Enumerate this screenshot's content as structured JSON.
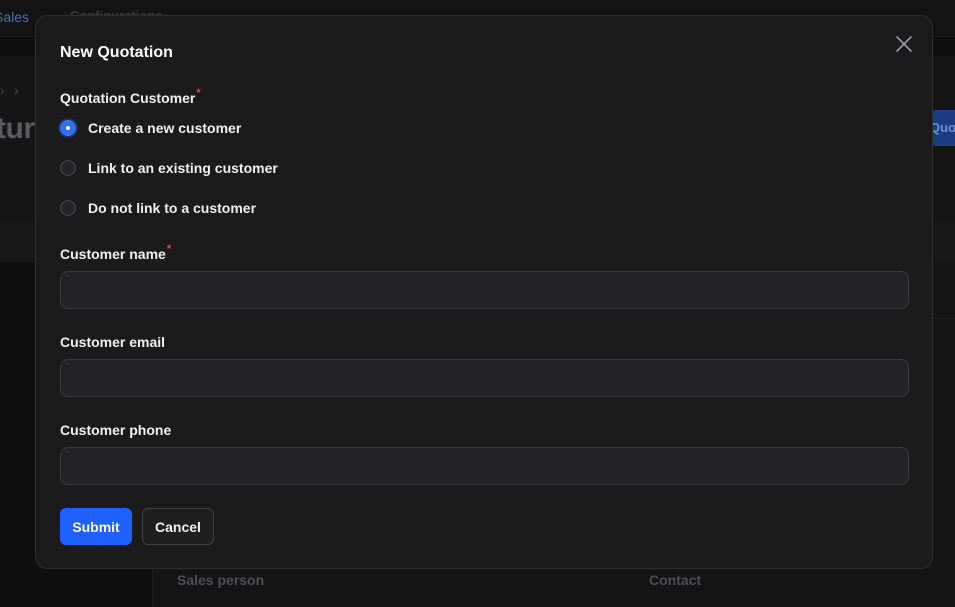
{
  "background": {
    "tabs": [
      "Sales",
      "Configurations"
    ],
    "page_title": "tur",
    "primary_action": "Quo",
    "card_labels": [
      "Sales person",
      "Contact"
    ]
  },
  "modal": {
    "title": "New Quotation",
    "close_icon": "close-icon",
    "quotation_customer": {
      "label": "Quotation Customer",
      "required_mark": "*",
      "selected": "Create a new customer",
      "options": [
        "Create a new customer",
        "Link to an existing customer",
        "Do not link to a customer"
      ]
    },
    "customer_name": {
      "label": "Customer name",
      "required_mark": "*",
      "value": "",
      "placeholder": ""
    },
    "customer_email": {
      "label": "Customer email",
      "value": "",
      "placeholder": ""
    },
    "customer_phone": {
      "label": "Customer phone",
      "value": "",
      "placeholder": ""
    },
    "submit_label": "Submit",
    "cancel_label": "Cancel"
  },
  "colors": {
    "accent": "#1f61ff",
    "required": "#e5484d",
    "modal_bg": "#1b1b1c"
  }
}
